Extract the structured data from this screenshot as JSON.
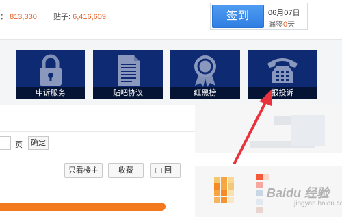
{
  "stats": {
    "prefix_num": "813,330",
    "posts_label": "贴子:",
    "posts_num": "6,416,609"
  },
  "sign": {
    "button_label": "签到",
    "date": "06月07日",
    "missed_prefix": "漏签",
    "missed_count": "0",
    "missed_suffix": "天"
  },
  "services": [
    {
      "label": "申诉服务",
      "icon": "lock-icon"
    },
    {
      "label": "贴吧协议",
      "icon": "document-icon"
    },
    {
      "label": "红黑榜",
      "icon": "ribbon-icon"
    },
    {
      "label": "报投诉",
      "icon": "phone-icon"
    }
  ],
  "pager": {
    "page_label": "页",
    "confirm_label": "确定"
  },
  "actions": {
    "only_author": "只看楼主",
    "favorite": "收藏",
    "reply": "回"
  },
  "watermark": {
    "brand": "Baidu 经验",
    "site": "jingyan.baidu.com"
  },
  "colors": {
    "accent": "#e8632b",
    "tile_bg": "#0d2a73",
    "sign_blue": "#2f7fe3",
    "arrow_red": "#e8323c",
    "orange_bar": "#f3791f"
  }
}
